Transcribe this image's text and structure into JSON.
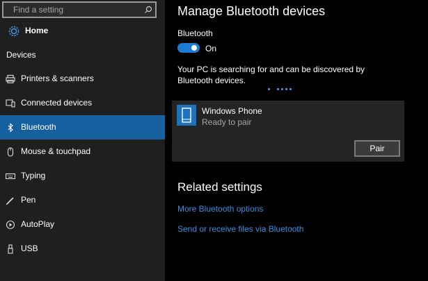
{
  "sidebar": {
    "search_placeholder": "Find a setting",
    "home_label": "Home",
    "section_label": "Devices",
    "items": [
      {
        "label": "Printers & scanners"
      },
      {
        "label": "Connected devices"
      },
      {
        "label": "Bluetooth"
      },
      {
        "label": "Mouse & touchpad"
      },
      {
        "label": "Typing"
      },
      {
        "label": "Pen"
      },
      {
        "label": "AutoPlay"
      },
      {
        "label": "USB"
      }
    ],
    "selected_item": "Bluetooth"
  },
  "main": {
    "title": "Manage Bluetooth devices",
    "bluetooth_label": "Bluetooth",
    "toggle_state": "On",
    "searching_text": "Your PC is searching for and can be discovered by Bluetooth devices.",
    "device": {
      "name": "Windows Phone",
      "status": "Ready to pair",
      "pair_label": "Pair"
    },
    "related_title": "Related settings",
    "links": [
      "More Bluetooth options",
      "Send or receive files via Bluetooth"
    ]
  },
  "colors": {
    "accent": "#1e73be",
    "link": "#3a8fe0",
    "sidebar_bg": "#1f1f1f",
    "main_bg": "#000000"
  }
}
